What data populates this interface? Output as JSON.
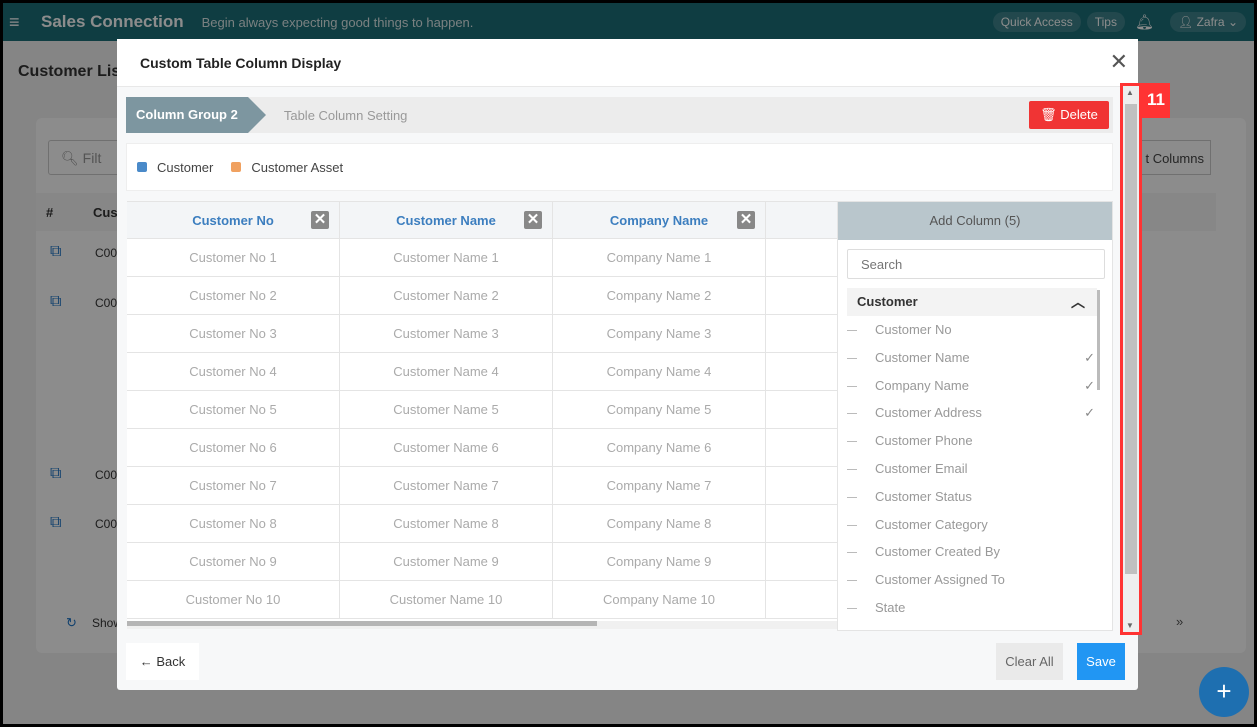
{
  "topbar": {
    "brand": "Sales Connection",
    "tagline": "Begin always expecting good things to happen.",
    "quick_access": "Quick Access",
    "tips": "Tips",
    "user": "Zafra"
  },
  "background": {
    "page_title": "Customer Lis",
    "search_placeholder": "Filt",
    "columns_button": "t Columns",
    "col_hash": "#",
    "col_customer": "Cus",
    "row_code": "C00",
    "footer_show": "Show",
    "footer_next": "»"
  },
  "modal": {
    "title": "Custom Table Column Display",
    "breadcrumb": {
      "active": "Column Group 2",
      "next": "Table Column Setting"
    },
    "delete_label": "Delete",
    "legend": [
      {
        "label": "Customer",
        "color": "#4a8ac9"
      },
      {
        "label": "Customer Asset",
        "color": "#f0a160"
      }
    ],
    "table": {
      "headers": [
        "Customer No",
        "Customer Name",
        "Company Name"
      ],
      "rows": [
        [
          "Customer No 1",
          "Customer Name 1",
          "Company Name 1"
        ],
        [
          "Customer No 2",
          "Customer Name 2",
          "Company Name 2"
        ],
        [
          "Customer No 3",
          "Customer Name 3",
          "Company Name 3"
        ],
        [
          "Customer No 4",
          "Customer Name 4",
          "Company Name 4"
        ],
        [
          "Customer No 5",
          "Customer Name 5",
          "Company Name 5"
        ],
        [
          "Customer No 6",
          "Customer Name 6",
          "Company Name 6"
        ],
        [
          "Customer No 7",
          "Customer Name 7",
          "Company Name 7"
        ],
        [
          "Customer No 8",
          "Customer Name 8",
          "Company Name 8"
        ],
        [
          "Customer No 9",
          "Customer Name 9",
          "Company Name 9"
        ],
        [
          "Customer No 10",
          "Customer Name 10",
          "Company Name 10"
        ]
      ]
    },
    "add_column": {
      "title": "Add Column (5)",
      "search_placeholder": "Search",
      "group": "Customer",
      "items": [
        {
          "label": "Customer No",
          "checked": true
        },
        {
          "label": "Customer Name",
          "checked": true
        },
        {
          "label": "Company Name",
          "checked": true
        },
        {
          "label": "Customer Address",
          "checked": false
        },
        {
          "label": "Customer Phone",
          "checked": false
        },
        {
          "label": "Customer Email",
          "checked": false
        },
        {
          "label": "Customer Status",
          "checked": false
        },
        {
          "label": "Customer Category",
          "checked": false
        },
        {
          "label": "Customer Created By",
          "checked": false
        },
        {
          "label": "Customer Assigned To",
          "checked": false
        },
        {
          "label": "State",
          "checked": false
        }
      ]
    },
    "back_label": "Back",
    "clear_label": "Clear All",
    "save_label": "Save"
  },
  "annotation": {
    "label": "11",
    "color": "#ff3333"
  }
}
